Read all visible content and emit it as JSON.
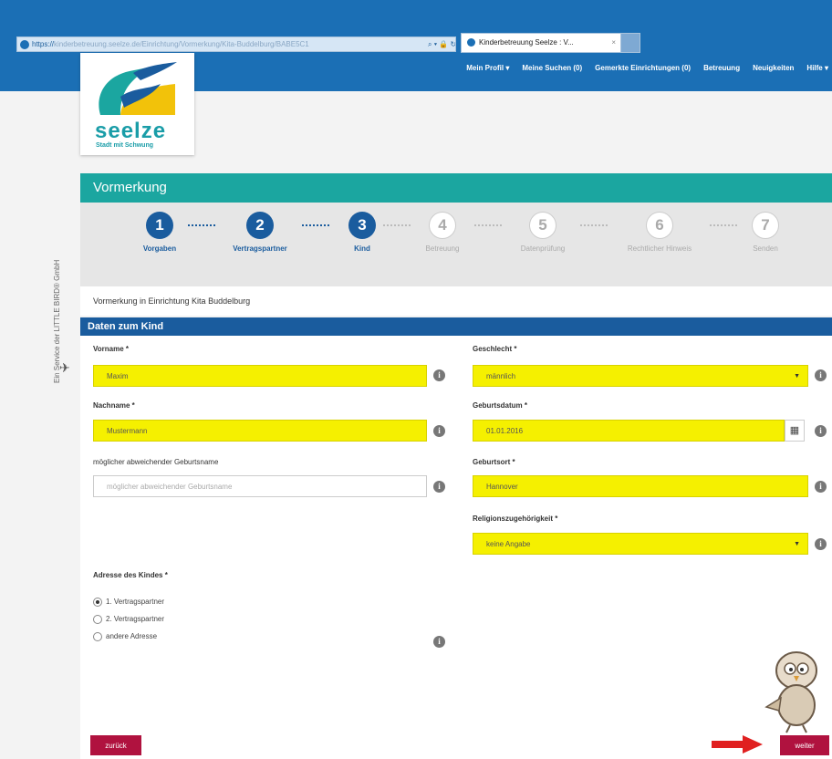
{
  "browser": {
    "address_prefix": "https://",
    "address_host": "kinderbetreuung.seelze.de",
    "address_path": "/Einrichtung/Vormerkung/Kita-Buddelburg/BABE5C1",
    "address_icons": "⌕ ▾ 🔒 ↻",
    "tab_title": "Kinderbetreuung Seelze : V...",
    "tab_close": "×"
  },
  "nav": {
    "items": [
      "Mein Profil ▾",
      "Meine Suchen (0)",
      "Gemerkte Einrichtungen (0)",
      "Betreuung",
      "Neuigkeiten",
      "Hilfe ▾"
    ]
  },
  "logo": {
    "word": "seelze",
    "tagline": "Stadt mit Schwung"
  },
  "side": {
    "text": "Ein Service der LITTLE BIRD® GmbH",
    "icon": "✈"
  },
  "panel": {
    "title": "Vormerkung"
  },
  "steps": [
    {
      "num": "1",
      "label": "Vorgaben"
    },
    {
      "num": "2",
      "label": "Vertragspartner"
    },
    {
      "num": "3",
      "label": "Kind"
    },
    {
      "num": "4",
      "label": "Betreuung"
    },
    {
      "num": "5",
      "label": "Datenprüfung"
    },
    {
      "num": "6",
      "label": "Rechtlicher Hinweis"
    },
    {
      "num": "7",
      "label": "Senden"
    }
  ],
  "info_line": "Vormerkung in Einrichtung Kita Buddelburg",
  "section": {
    "title": "Daten zum Kind"
  },
  "form": {
    "vorname_label": "Vorname *",
    "vorname_value": "Maxim",
    "nachname_label": "Nachname *",
    "nachname_value": "Mustermann",
    "geburtsname_label": "möglicher abweichender Geburtsname",
    "geburtsname_placeholder": "möglicher abweichender Geburtsname",
    "geschlecht_label": "Geschlecht *",
    "geschlecht_value": "männlich",
    "geburtsdatum_label": "Geburtsdatum *",
    "geburtsdatum_value": "01.01.2016",
    "geburtsort_label": "Geburtsort *",
    "geburtsort_value": "Hannover",
    "religion_label": "Religionszugehörigkeit *",
    "religion_value": "keine Angabe",
    "adresse_label": "Adresse des Kindes *",
    "adresse_options": [
      "1. Vertragspartner",
      "2. Vertragspartner",
      "andere Adresse"
    ],
    "adresse_selected": "1. Vertragspartner",
    "info_glyph": "i",
    "dropdown_arrow": "▼",
    "calendar_glyph": "▦"
  },
  "buttons": {
    "back": "zurück",
    "next": "weiter"
  },
  "colors": {
    "browser_blue": "#1b6fb5",
    "teal": "#1ba6a0",
    "step_blue": "#1a5c9e",
    "required_yellow": "#f5f000",
    "button_red": "#b0123f"
  }
}
